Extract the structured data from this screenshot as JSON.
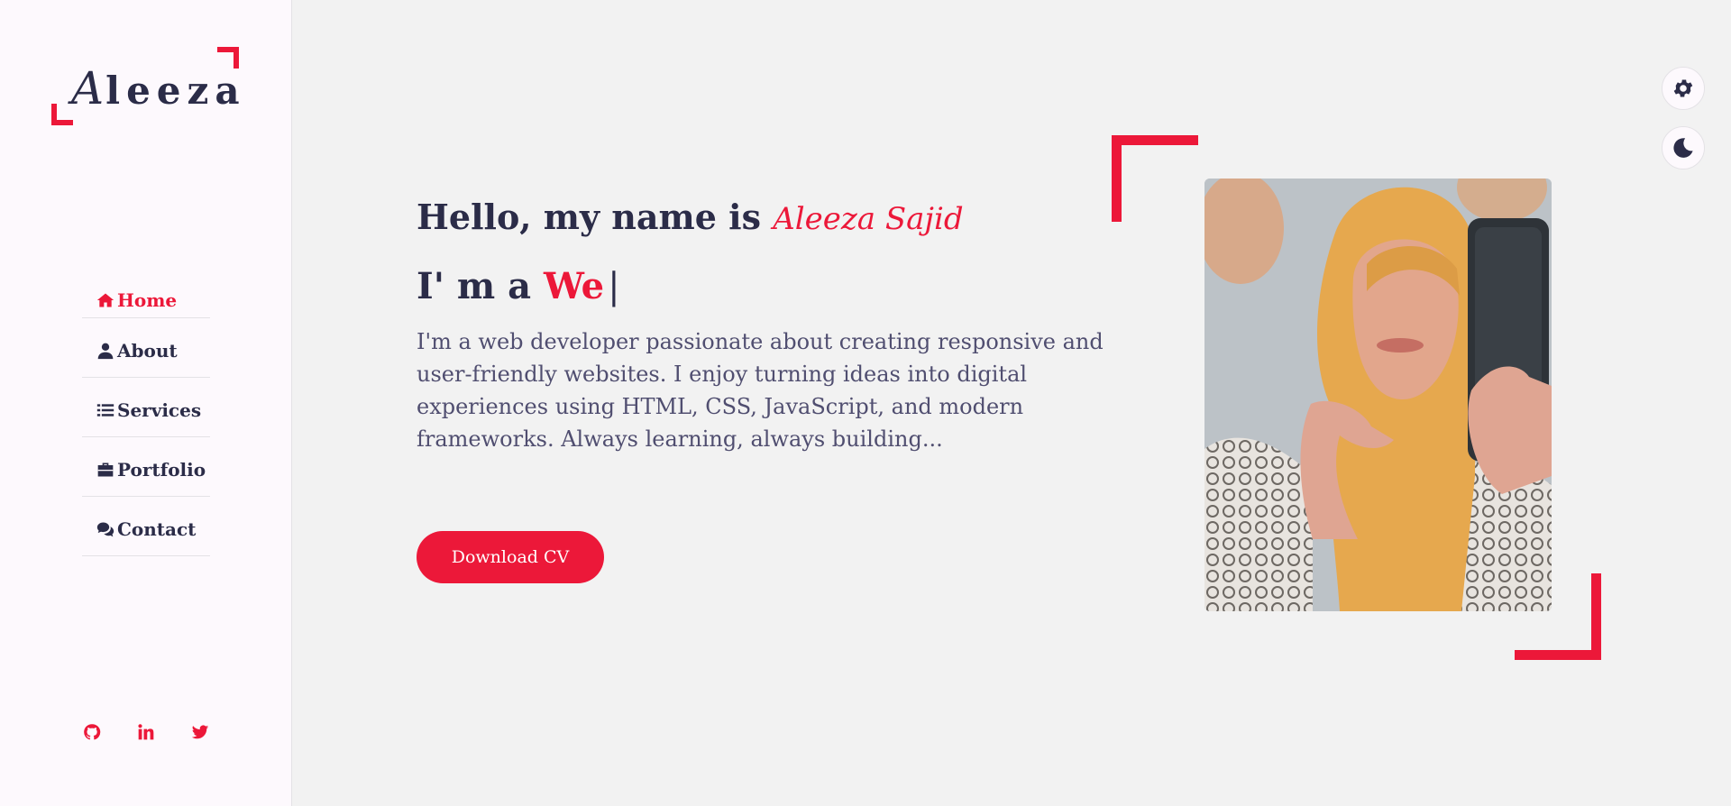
{
  "logo": {
    "first_letter": "A",
    "rest": "leeza"
  },
  "nav": {
    "items": [
      {
        "label": "Home",
        "icon": "home-icon",
        "active": true
      },
      {
        "label": "About",
        "icon": "user-icon"
      },
      {
        "label": "Services",
        "icon": "list-icon"
      },
      {
        "label": "Portfolio",
        "icon": "briefcase-icon"
      },
      {
        "label": "Contact",
        "icon": "comments-icon"
      }
    ]
  },
  "social": [
    "github-icon",
    "linkedin-icon",
    "twitter-icon"
  ],
  "hero": {
    "greeting": "Hello, my name is",
    "name": "Aleeza Sajid",
    "typing_prefix": "I' m a",
    "typing_text": "We",
    "cursor": "|",
    "description": "I'm a web developer passionate about creating responsive and user-friendly websites. I enjoy turning ideas into digital experiences using HTML, CSS, JavaScript, and modern frameworks. Always learning, always building...",
    "cv_button": "Download CV"
  },
  "controls": [
    "gear-icon",
    "moon-icon"
  ],
  "colors": {
    "accent": "#ec1839",
    "text": "#2b2c48",
    "sidebar_bg": "#fdf9fd",
    "page_bg": "#f2f2f2"
  }
}
